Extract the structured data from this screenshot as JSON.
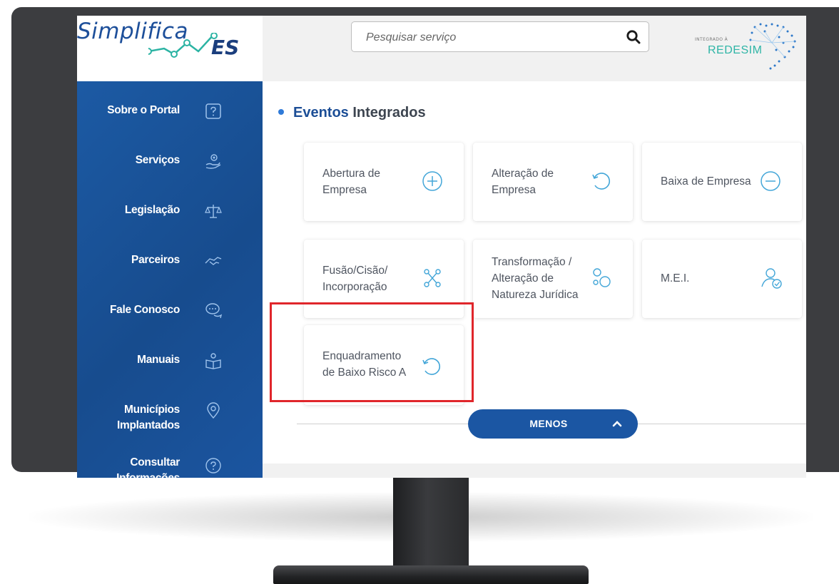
{
  "header": {
    "logo_text": "Simplifica",
    "logo_suffix": "ES",
    "search": {
      "placeholder": "Pesquisar serviço",
      "value": ""
    },
    "partner_logo": {
      "small_text": "INTEGRADO À",
      "word": "REDESIM"
    }
  },
  "sidebar": {
    "items": [
      {
        "label": "Sobre o Portal",
        "icon": "question-box-icon"
      },
      {
        "label": "Serviços",
        "icon": "hand-gear-icon"
      },
      {
        "label": "Legislação",
        "icon": "scales-icon"
      },
      {
        "label": "Parceiros",
        "icon": "handshake-icon"
      },
      {
        "label": "Fale Conosco",
        "icon": "chat-bubbles-icon"
      },
      {
        "label": "Manuais",
        "icon": "book-reader-icon"
      },
      {
        "label": "Municípios\nImplantados",
        "icon": "map-pin-icon"
      },
      {
        "label": "Consultar\nInformações",
        "icon": "question-circle-icon"
      }
    ]
  },
  "main": {
    "section_title_strong": "Eventos",
    "section_title_rest": "Integrados",
    "cards": [
      {
        "label": "Abertura de\nEmpresa",
        "icon": "plus-circle-icon"
      },
      {
        "label": "Alteração de\nEmpresa",
        "icon": "refresh-icon"
      },
      {
        "label": "Baixa de Empresa",
        "icon": "minus-circle-icon"
      },
      {
        "label": "Fusão/Cisão/\nIncorporação",
        "icon": "merge-nodes-icon"
      },
      {
        "label": "Transformação /\nAlteração de\nNatureza Jurídica",
        "icon": "transform-circles-icon"
      },
      {
        "label": "M.E.I.",
        "icon": "user-check-icon"
      },
      {
        "label": "Enquadramento\nde Baixo Risco A",
        "icon": "refresh-icon"
      }
    ],
    "less_button": "MENOS"
  },
  "colors": {
    "brand_blue": "#1c5aa4",
    "icon_cyan": "#43a6d8",
    "highlight_red": "#e0262b"
  }
}
